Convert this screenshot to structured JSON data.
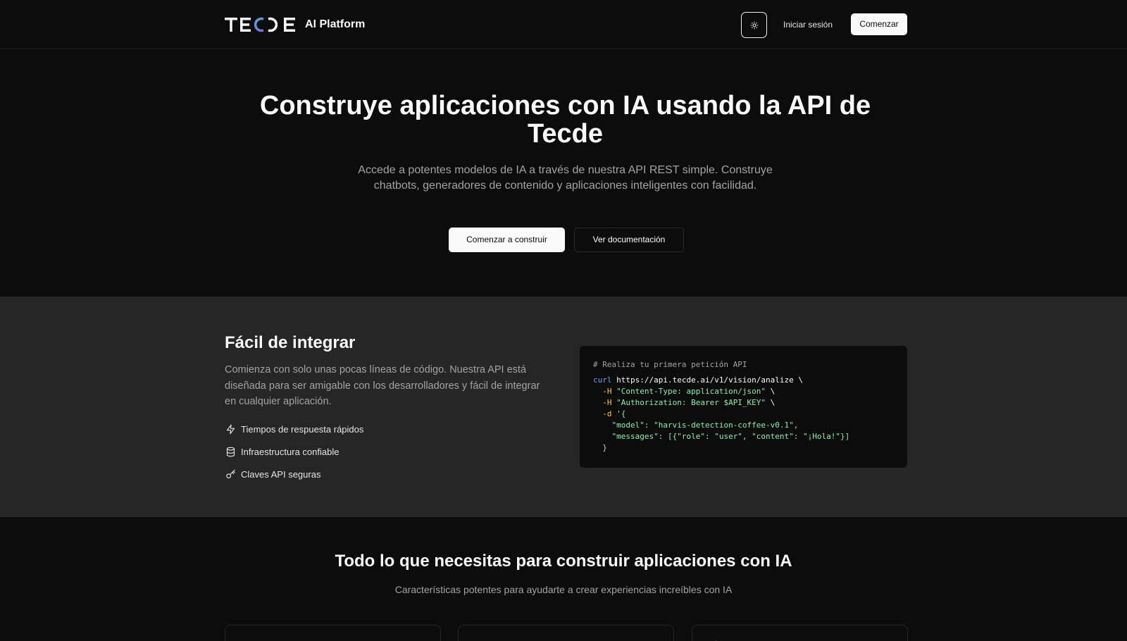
{
  "header": {
    "logo_text": "TECDE",
    "brand_subtitle": "AI Platform",
    "theme_toggle_icon": "sun-icon",
    "login_label": "Iniciar sesión",
    "start_label": "Comenzar"
  },
  "hero": {
    "title": "Construye aplicaciones con IA usando la API de Tecde",
    "subtitle": "Accede a potentes modelos de IA a través de nuestra API REST simple. Construye chatbots, generadores de contenido y aplicaciones inteligentes con facilidad.",
    "primary_cta": "Comenzar a construir",
    "secondary_cta": "Ver documentación"
  },
  "integrate": {
    "title": "Fácil de integrar",
    "description": "Comienza con solo unas pocas líneas de código. Nuestra API está diseñada para ser amigable con los desarrolladores y fácil de integrar en cualquier aplicación.",
    "features": [
      {
        "icon": "lightning-icon",
        "label": "Tiempos de respuesta rápidos"
      },
      {
        "icon": "database-icon",
        "label": "Infraestructura confiable"
      },
      {
        "icon": "key-icon",
        "label": "Claves API seguras"
      }
    ],
    "code": {
      "comment": "# Realiza tu primera petición API",
      "command": "curl",
      "url": "https://api.tecde.ai/v1/vision/analize",
      "line_cont": " \\",
      "h_flag": "-H",
      "header1": "\"Content-Type: application/json\"",
      "header2": "\"Authorization: Bearer $API_KEY\"",
      "d_flag": "-d",
      "body_open": "'{",
      "body_model": "\"model\": \"harvis-detection-coffee-v0.1\",",
      "body_messages": "\"messages\": [{\"role\": \"user\", \"content\": \"¡Hola!\"}]",
      "body_close": "}"
    }
  },
  "features_section": {
    "title": "Todo lo que necesitas para construir aplicaciones con IA",
    "subtitle": "Características potentes para ayudarte a crear experiencias increíbles con IA"
  },
  "colors": {
    "background": "#0c0c0c",
    "section_alt": "#262626",
    "text_primary": "#fafafa",
    "text_muted": "#a3a3a3",
    "logo_gradient_start": "#4ea8de",
    "logo_gradient_end": "#7b6cd9",
    "code_command": "#60a5fa",
    "code_flag": "#facc15",
    "code_string": "#86efac"
  }
}
